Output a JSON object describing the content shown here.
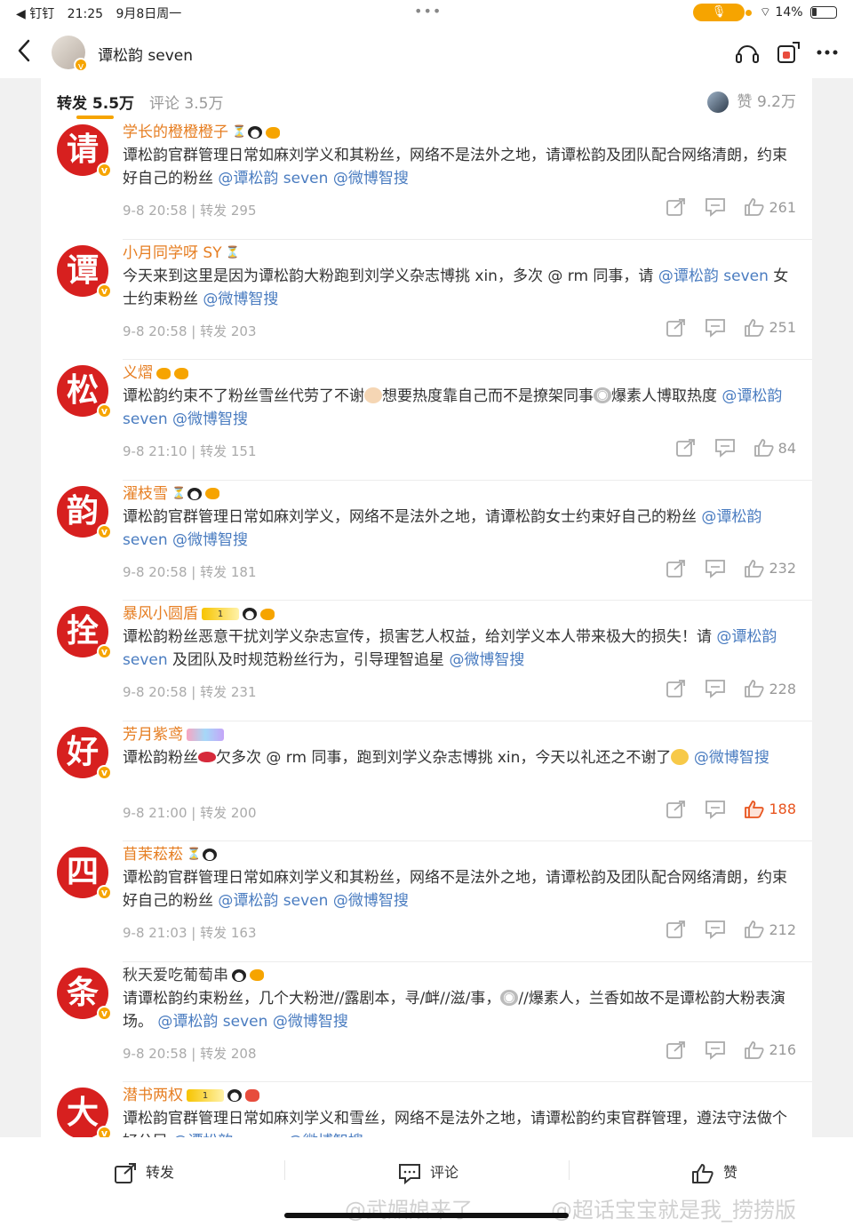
{
  "status_bar": {
    "back_app": "◀ 钉钉",
    "time": "21:25",
    "date": "9月8日周一",
    "battery": "14%"
  },
  "nav": {
    "username": "谭松韵 seven"
  },
  "tabs": {
    "repost": "转发 5.5万",
    "comment": "评论 3.5万",
    "likes": "赞 9.2万"
  },
  "reposts": [
    {
      "avatar_char": "请",
      "nickname": "学长的橙橙橙子",
      "badges": [
        "hourglass",
        "panda",
        "fish"
      ],
      "text": "谭松韵官群管理日常如麻刘学义和其粉丝，网络不是法外之地，请谭松韵及团队配合网络清朗，约束好自己的粉丝",
      "mentions": [
        "@谭松韵 seven",
        "@微博智搜"
      ],
      "time": "9-8 20:58",
      "reposts": "转发 295",
      "likes": "261",
      "liked": false
    },
    {
      "avatar_char": "谭",
      "nickname": "小月同学呀 SY",
      "badges": [
        "hourglass"
      ],
      "text": "今天来到这里是因为谭松韵大粉跑到刘学义杂志博挑 xin，多次 @ rm 同事，请",
      "mention_inline": "@谭松韵 seven",
      "text2": "女士约束粉丝",
      "mentions": [
        "@微博智搜"
      ],
      "time": "9-8 20:58",
      "reposts": "转发 203",
      "likes": "251",
      "liked": false
    },
    {
      "avatar_char": "松",
      "nickname": "义熠",
      "badges": [
        "bee",
        "fish"
      ],
      "text": "谭松韵约束不了粉丝雪丝代劳了不谢",
      "text_mid": "想要热度靠自己而不是撩架同事",
      "text_end": "爆素人博取热度",
      "mentions": [
        "@谭松韵 seven",
        "@微博智搜"
      ],
      "time": "9-8 21:10",
      "reposts": "转发 151",
      "likes": "84",
      "liked": false
    },
    {
      "avatar_char": "韵",
      "nickname": "濯枝雪",
      "badges": [
        "hourglass",
        "panda",
        "fish"
      ],
      "text": "谭松韵官群管理日常如麻刘学义，网络不是法外之地，请谭松韵女士约束好自己的粉丝",
      "mentions": [
        "@谭松韵 seven",
        "@微博智搜"
      ],
      "time": "9-8 20:58",
      "reposts": "转发 181",
      "likes": "232",
      "liked": false
    },
    {
      "avatar_char": "拴",
      "nickname": "暴风小圆盾",
      "badges": [
        "crown",
        "panda",
        "fish"
      ],
      "crown_label": "1",
      "text": "谭松韵粉丝恶意干扰刘学义杂志宣传，损害艺人权益，给刘学义本人带来极大的损失！请",
      "mention_inline": "@谭松韵 seven",
      "text2": "及团队及时规范粉丝行为，引导理智追星",
      "mentions": [
        "@微博智搜"
      ],
      "time": "9-8 20:58",
      "reposts": "转发 231",
      "likes": "228",
      "liked": false
    },
    {
      "avatar_char": "好",
      "nickname": "芳月紫鸢",
      "badges": [
        "rainbow"
      ],
      "text": "谭松韵粉丝",
      "text_mid": "欠多次 @ rm 同事，跑到刘学义杂志博挑 xin，今天以礼还之不谢了",
      "mentions": [
        "@微博智搜"
      ],
      "time": "9-8 21:00",
      "reposts": "转发 200",
      "likes": "188",
      "liked": true
    },
    {
      "avatar_char": "四",
      "nickname": "苜茉菘菘",
      "badges": [
        "hourglass",
        "panda"
      ],
      "text": "谭松韵官群管理日常如麻刘学义和其粉丝，网络不是法外之地，请谭松韵及团队配合网络清朗，约束好自己的粉丝",
      "mentions": [
        "@谭松韵 seven",
        "@微博智搜"
      ],
      "time": "9-8 21:03",
      "reposts": "转发 163",
      "likes": "212",
      "liked": false
    },
    {
      "avatar_char": "条",
      "nickname": "秋天爱吃葡萄串",
      "plain": true,
      "badges": [
        "panda",
        "fish"
      ],
      "text": "请谭松韵约束粉丝，几个大粉泄//露剧本，寻/衅//滋/事，",
      "text_mid": "//爆素人，兰香如故不是谭松韵大粉表演场。",
      "mentions": [
        "@谭松韵 seven",
        "@微博智搜"
      ],
      "time": "9-8 20:58",
      "reposts": "转发 208",
      "likes": "216",
      "liked": false
    },
    {
      "avatar_char": "大",
      "nickname": "潜书两权",
      "badges": [
        "crown",
        "panda",
        "mask"
      ],
      "crown_label": "1",
      "text": "谭松韵官群管理日常如麻刘学义和雪丝，网络不是法外之地，请谭松韵约束官群管理，遵法守法做个好公民",
      "mentions": [
        "@谭松韵 seven",
        "@微博智搜"
      ],
      "time": "",
      "reposts": "",
      "likes": "",
      "liked": false
    }
  ],
  "bottom_bar": {
    "repost": "转发",
    "comment": "评论",
    "like": "赞"
  },
  "watermarks": [
    "@武媚娘来了",
    "@超话宝宝就是我_捞捞版"
  ],
  "colors": {
    "accent": "#f6a400",
    "nickname": "#e67e22",
    "mention": "#4a7cc0",
    "avatar_bg": "#d7201f",
    "liked": "#e8541e"
  }
}
